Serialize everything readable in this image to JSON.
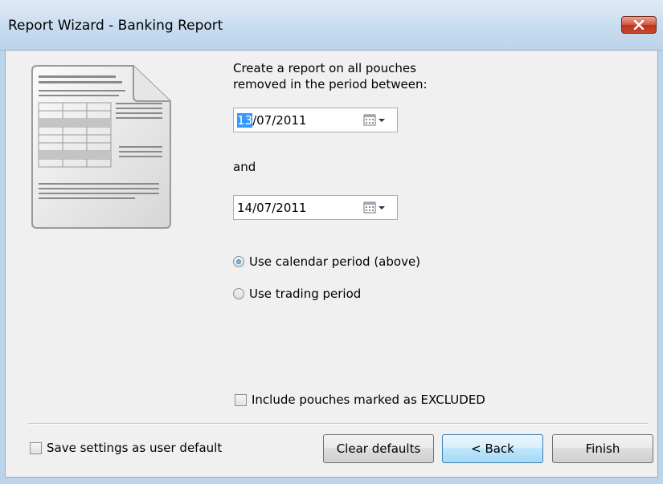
{
  "window": {
    "title": "Report Wizard - Banking Report"
  },
  "prompt": {
    "text": "Create a report on all pouches\nremoved in the period between:"
  },
  "start_date": {
    "selected_part": "13",
    "rest": "/07/2011"
  },
  "and_label": "and",
  "end_date": {
    "value": "14/07/2011"
  },
  "period_options": {
    "calendar": {
      "label": "Use calendar period (above)",
      "checked": true
    },
    "trading": {
      "label": "Use trading period",
      "checked": false
    }
  },
  "include_excluded": {
    "label": "Include pouches marked as EXCLUDED",
    "checked": false
  },
  "save_default": {
    "label": "Save settings as user default",
    "checked": false
  },
  "buttons": {
    "clear_defaults": "Clear defaults",
    "back": "< Back",
    "finish": "Finish"
  },
  "icons": {
    "close": "close-icon",
    "report": "report-document-icon",
    "calendar": "calendar-icon",
    "dropdown": "chevron-down-icon"
  },
  "colors": {
    "title_bar": "#c7dbef",
    "close_button": "#c9462c",
    "selection": "#3399ff",
    "default_button": "#bee6fd"
  }
}
